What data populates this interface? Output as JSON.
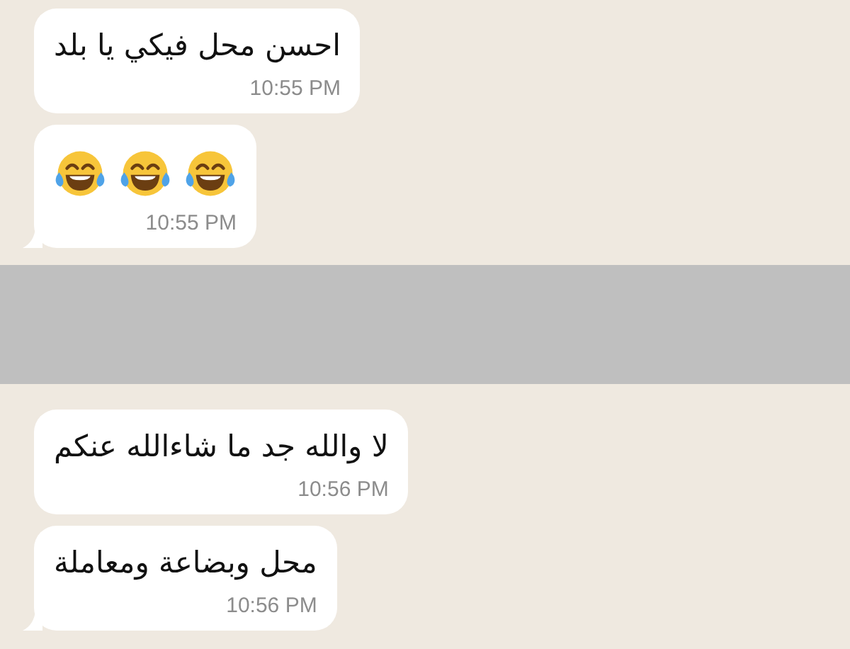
{
  "chat": [
    {
      "kind": "message",
      "text": "احسن محل فيكي يا بلد",
      "time": "10:55 PM",
      "tail": false
    },
    {
      "kind": "emoji_message",
      "emoji": [
        {
          "kind": "tears-of-joy"
        },
        {
          "kind": "tears-of-joy"
        },
        {
          "kind": "tears-of-joy"
        }
      ],
      "time": "10:55 PM",
      "tail": true
    },
    {
      "kind": "redaction"
    },
    {
      "kind": "message",
      "text": "لا والله جد ما شاءالله عنكم",
      "time": "10:56 PM",
      "tail": false
    },
    {
      "kind": "message",
      "text": "محل وبضاعة ومعاملة",
      "time": "10:56 PM",
      "tail": true
    }
  ]
}
